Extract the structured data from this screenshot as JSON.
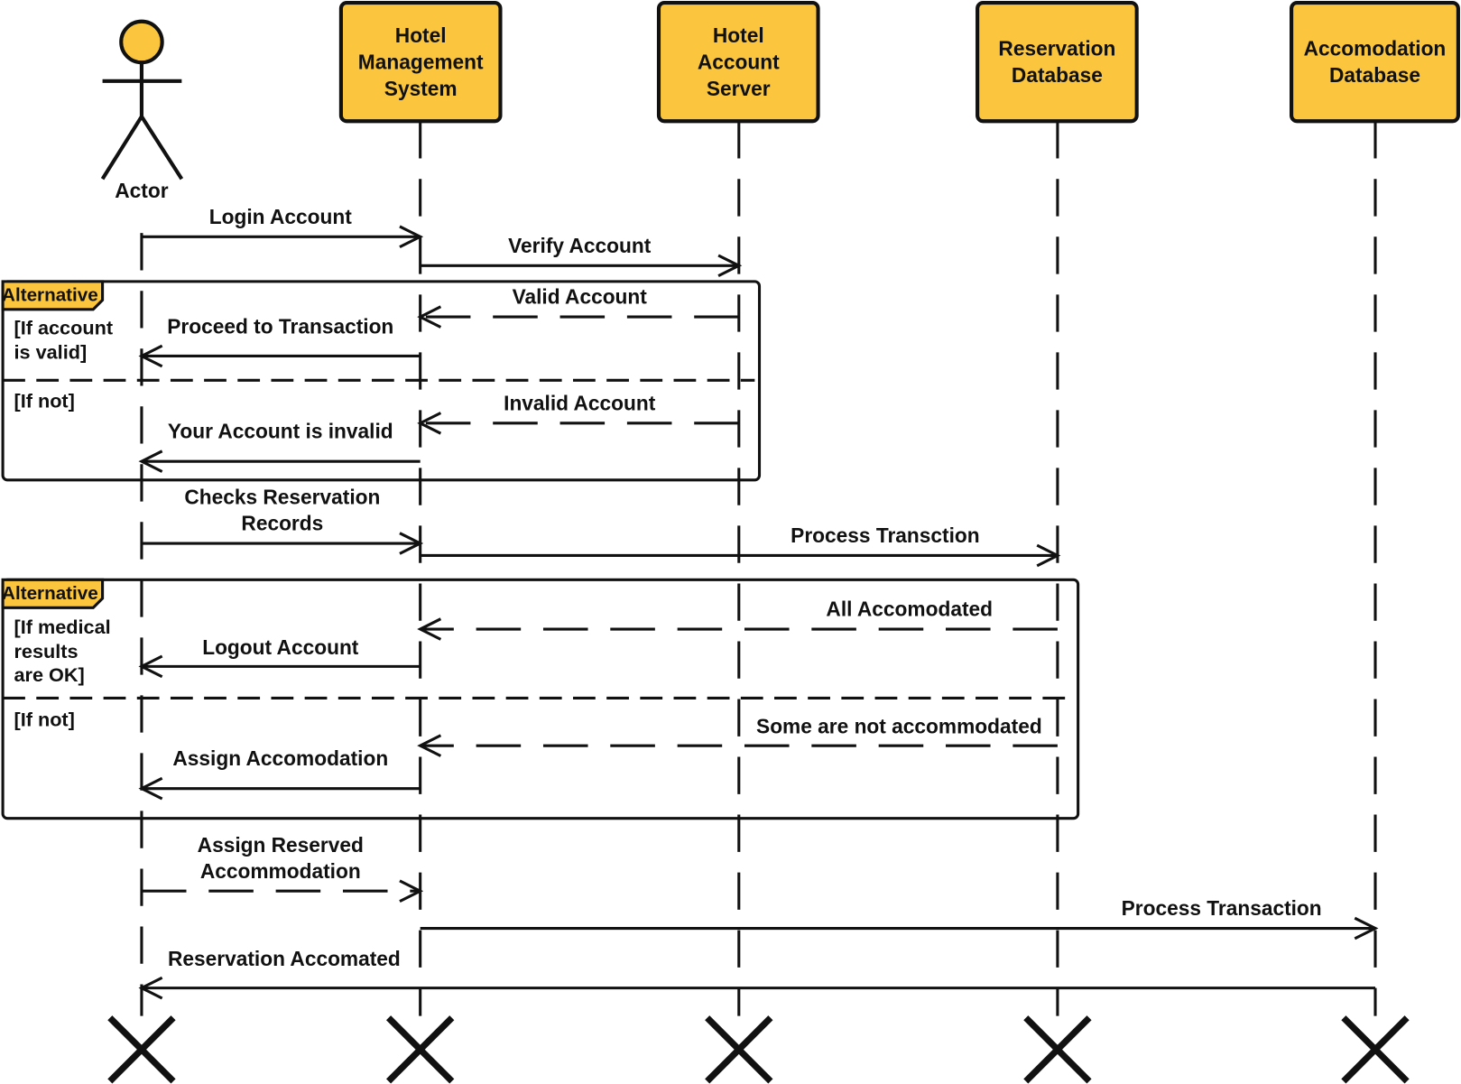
{
  "colors": {
    "participant_fill": "#FBC63D",
    "stroke": "#111111",
    "background": "#FFFFFF"
  },
  "actor": {
    "label": "Actor"
  },
  "participants": [
    {
      "id": "hms",
      "lines": [
        "Hotel",
        "Management",
        "System"
      ]
    },
    {
      "id": "has",
      "lines": [
        "Hotel",
        "Account",
        "Server"
      ]
    },
    {
      "id": "rd",
      "lines": [
        "Reservation",
        "Database"
      ]
    },
    {
      "id": "ad",
      "lines": [
        "Accomodation",
        "Database"
      ]
    }
  ],
  "messages": [
    {
      "from": "actor",
      "to": "hms",
      "style": "solid",
      "lines": [
        "Login Account"
      ]
    },
    {
      "from": "hms",
      "to": "has",
      "style": "solid",
      "lines": [
        "Verify Account"
      ]
    },
    {
      "from": "has",
      "to": "hms",
      "style": "dashed",
      "lines": [
        "Valid Account"
      ]
    },
    {
      "from": "hms",
      "to": "actor",
      "style": "solid",
      "lines": [
        "Proceed to Transaction"
      ]
    },
    {
      "from": "has",
      "to": "hms",
      "style": "dashed",
      "lines": [
        "Invalid Account"
      ]
    },
    {
      "from": "hms",
      "to": "actor",
      "style": "solid",
      "lines": [
        "Your Account is invalid"
      ]
    },
    {
      "from": "actor",
      "to": "hms",
      "style": "solid",
      "lines": [
        "Checks Reservation",
        "Records"
      ]
    },
    {
      "from": "hms",
      "to": "rd",
      "style": "solid",
      "lines": [
        "Process Transction"
      ]
    },
    {
      "from": "rd",
      "to": "hms",
      "style": "dashed",
      "lines": [
        "All Accomodated"
      ]
    },
    {
      "from": "hms",
      "to": "actor",
      "style": "solid",
      "lines": [
        "Logout Account"
      ]
    },
    {
      "from": "rd",
      "to": "hms",
      "style": "dashed",
      "lines": [
        "Some are not accommodated"
      ]
    },
    {
      "from": "hms",
      "to": "actor",
      "style": "solid",
      "lines": [
        "Assign Accomodation"
      ]
    },
    {
      "from": "actor",
      "to": "hms",
      "style": "dashed",
      "lines": [
        "Assign Reserved",
        "Accommodation"
      ]
    },
    {
      "from": "hms",
      "to": "ad",
      "style": "solid",
      "lines": [
        "Process Transaction"
      ]
    },
    {
      "from": "ad",
      "to": "actor",
      "style": "solid",
      "lines": [
        "Reservation Accomated"
      ]
    }
  ],
  "fragments": [
    {
      "label": "Alternative",
      "guards": [
        [
          "[If account",
          "is valid]"
        ],
        [
          "[If not]"
        ]
      ]
    },
    {
      "label": "Alternative",
      "guards": [
        [
          "[If medical",
          "results",
          "are OK]"
        ],
        [
          "[If not]"
        ]
      ]
    }
  ]
}
